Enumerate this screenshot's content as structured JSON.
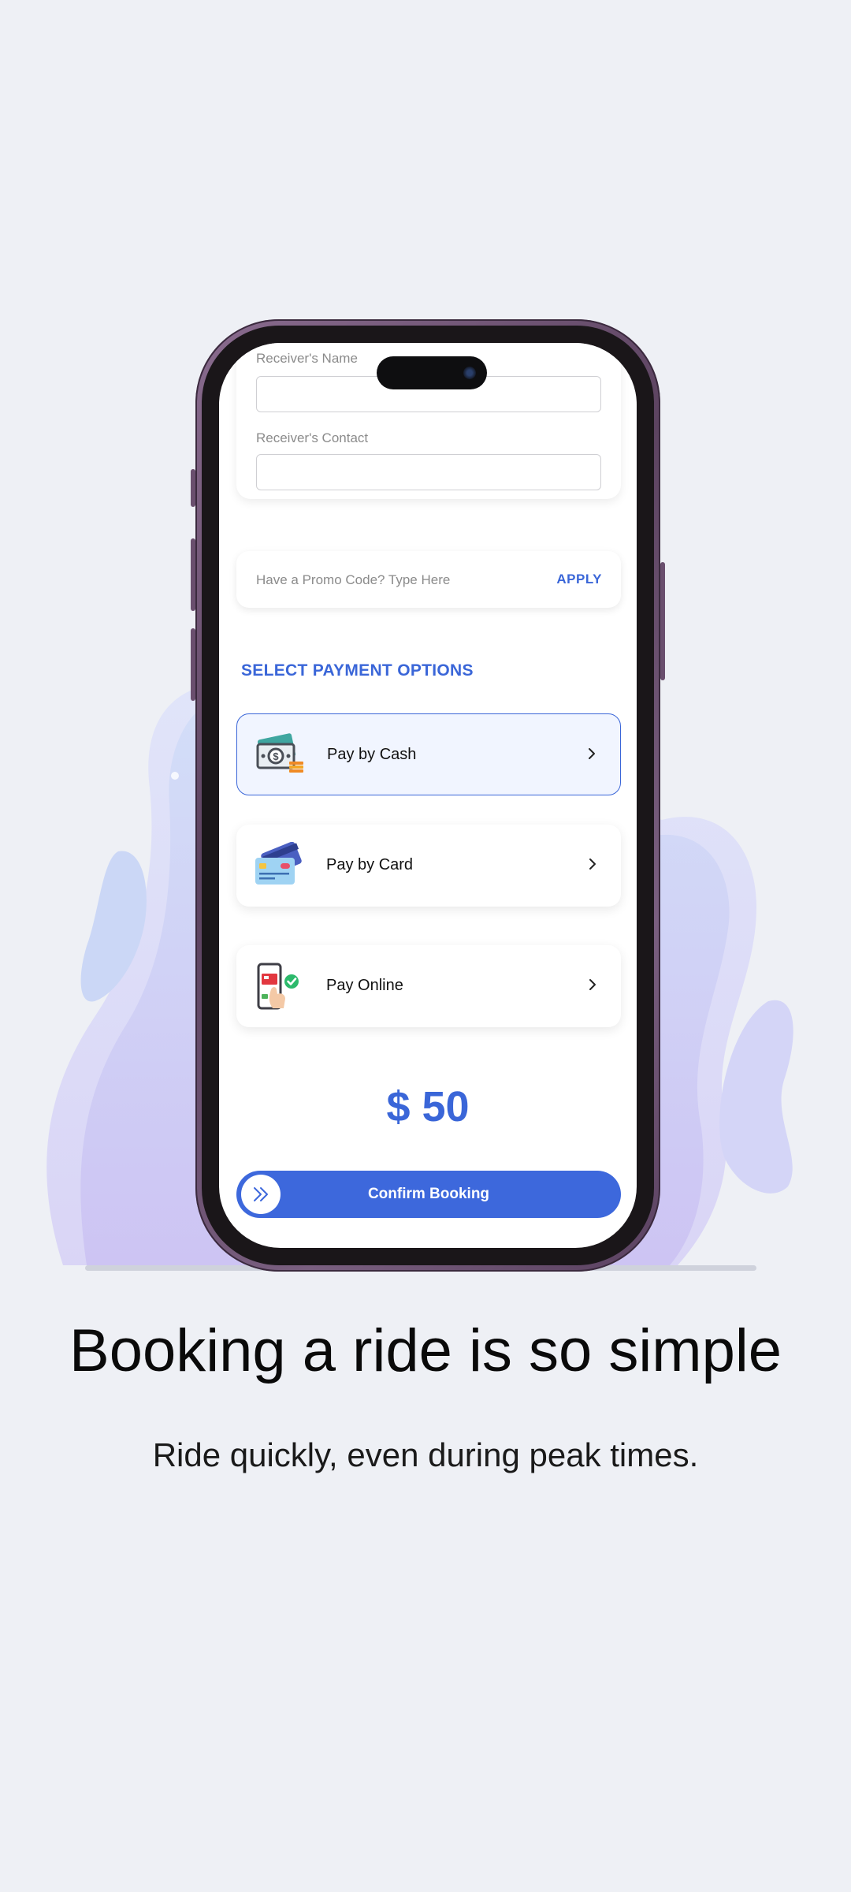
{
  "form": {
    "receiver_name_label": "Receiver's Name",
    "receiver_name_value": "",
    "receiver_contact_label": "Receiver's Contact",
    "receiver_contact_value": ""
  },
  "promo": {
    "placeholder": "Have a Promo Code? Type Here",
    "apply_label": "APPLY"
  },
  "payment": {
    "section_title": "SELECT PAYMENT OPTIONS",
    "options": [
      {
        "label": "Pay by Cash",
        "icon": "cash-icon",
        "selected": true
      },
      {
        "label": "Pay by Card",
        "icon": "credit-card-icon",
        "selected": false
      },
      {
        "label": "Pay Online",
        "icon": "mobile-payment-icon",
        "selected": false
      }
    ]
  },
  "price": "$ 50",
  "confirm_label": "Confirm Booking",
  "onboarding": {
    "headline": "Booking a ride is so simple",
    "subline": "Ride quickly, even during peak times."
  },
  "colors": {
    "accent": "#3a66d8",
    "background": "#eef0f5",
    "phone_frame": "#6a4f6e"
  }
}
